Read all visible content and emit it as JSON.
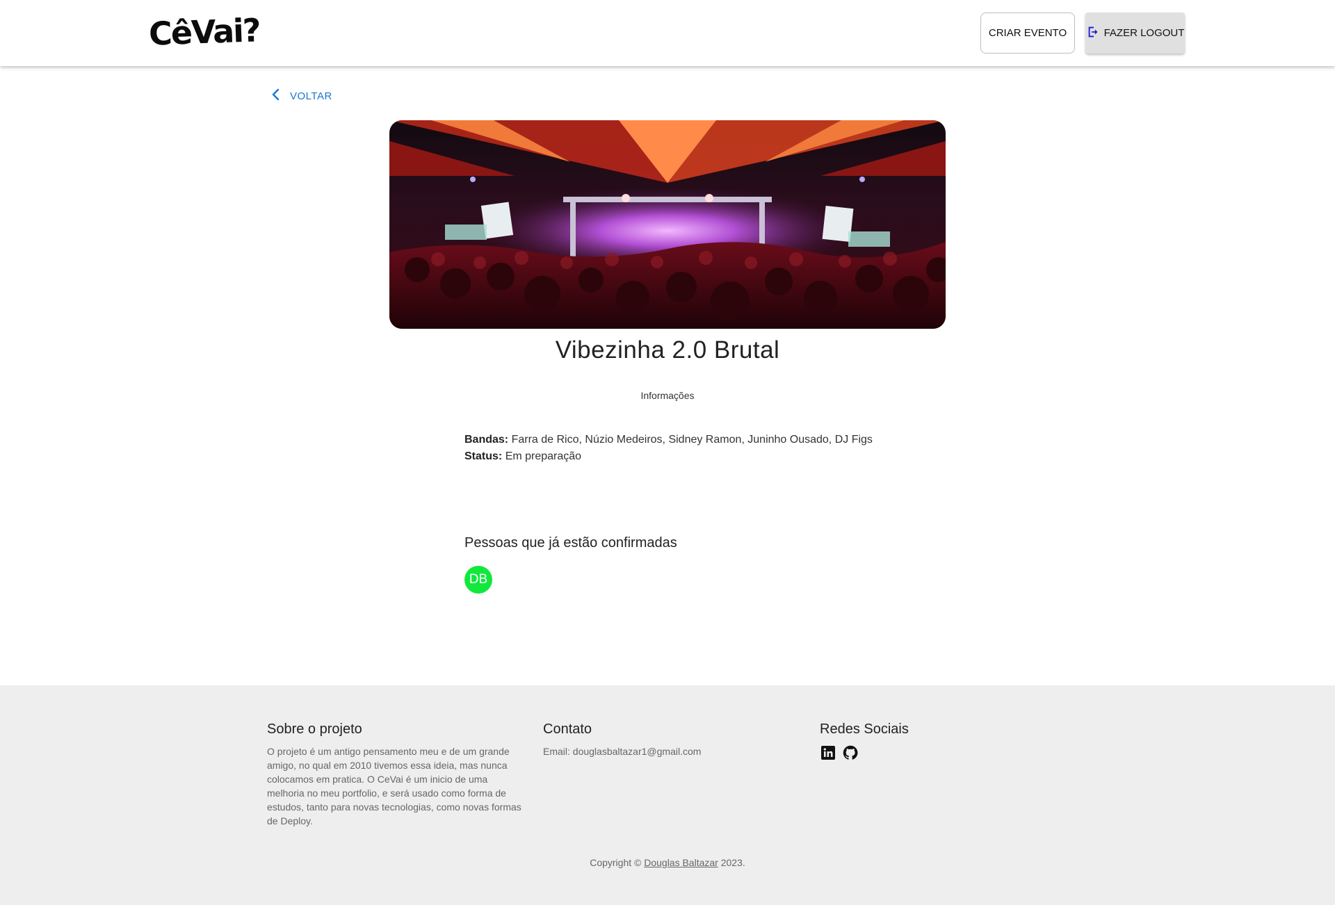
{
  "header": {
    "logo_text": "CêVai?",
    "create_event_label": "CRIAR EVENTO",
    "logout_label": "FAZER LOGOUT"
  },
  "nav": {
    "back_label": "VOLTAR"
  },
  "event": {
    "title": "Vibezinha 2.0 Brutal",
    "tab_label": "Informações",
    "bandas_label": "Bandas:",
    "bandas_value": "Farra de Rico, Núzio Medeiros, Sidney Ramon, Juninho Ousado, DJ Figs",
    "status_label": "Status:",
    "status_value": "Em preparação"
  },
  "confirmed": {
    "title": "Pessoas que já estão confirmadas",
    "attendees": [
      {
        "initials": "DB",
        "color": "#10e83c"
      }
    ]
  },
  "footer": {
    "about_title": "Sobre o projeto",
    "about_text": "O projeto é um antigo pensamento meu e de um grande amigo, no qual em 2010 tivemos essa ideia, mas nunca colocamos em pratica. O CeVai é um inicio de uma melhoria no meu portfolio, e será usado como forma de estudos, tanto para novas tecnologias, como novas formas de Deploy.",
    "contact_title": "Contato",
    "contact_email": "Email: douglasbaltazar1@gmail.com",
    "social_title": "Redes Sociais",
    "social_icons": [
      "linkedin-icon",
      "github-icon"
    ],
    "copyright_prefix": "Copyright ©",
    "copyright_author": "Douglas Baltazar",
    "copyright_suffix": "2023."
  },
  "colors": {
    "accent": "#1976d2",
    "avatar": "#10e83c",
    "footer_bg": "#eeeeee"
  }
}
